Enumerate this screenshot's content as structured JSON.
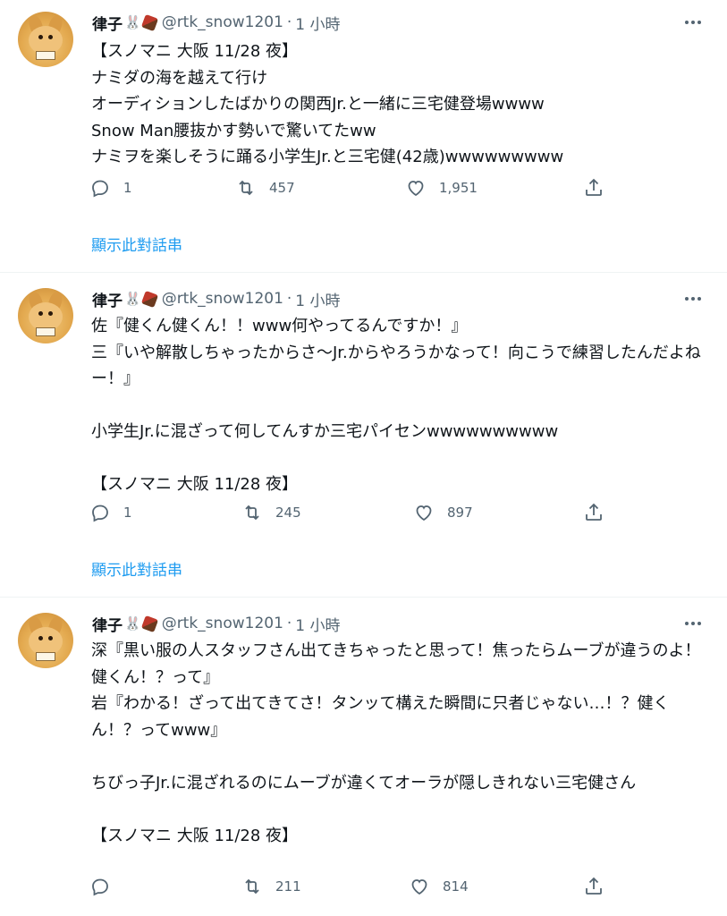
{
  "colors": {
    "link": "#1d9bf0",
    "secondary": "#536471",
    "text": "#0f1419",
    "divider": "#eff3f4"
  },
  "tweets": [
    {
      "name": "律子",
      "name_emoji": "rabbit-and-chocolate",
      "handle": "@rtk_snow1201",
      "dot": "·",
      "time": "1 小時",
      "text": "【スノマニ 大阪 11/28 夜】\nナミダの海を越えて行け\nオーディションしたばかりの関西Jr.と一緒に三宅健登場wwww\nSnow Man腰抜かす勢いで驚いてたww\nナミヲを楽しそうに踊る小学生Jr.と三宅健(42歳)wwwwwwwww",
      "replies": "1",
      "retweets": "457",
      "likes": "1,951",
      "show_thread": "顯示此對話串"
    },
    {
      "name": "律子",
      "name_emoji": "rabbit-and-chocolate",
      "handle": "@rtk_snow1201",
      "dot": "·",
      "time": "1 小時",
      "text": "佐『健くん健くん！！www何やってるんですか！』\n三『いや解散しちゃったからさ〜Jr.からやろうかなって！向こうで練習したんだよねー！』\n\n小学生Jr.に混ざって何してんすか三宅パイセンwwwwwwwwww\n\n【スノマニ 大阪 11/28 夜】",
      "replies": "1",
      "retweets": "245",
      "likes": "897",
      "show_thread": "顯示此對話串"
    },
    {
      "name": "律子",
      "name_emoji": "rabbit-and-chocolate",
      "handle": "@rtk_snow1201",
      "dot": "·",
      "time": "1 小時",
      "text": "深『黒い服の人スタッフさん出てきちゃったと思って！焦ったらムーブが違うのよ！健くん！？って』\n岩『わかる！ざって出てきてさ！タンッて構えた瞬間に只者じゃない…！？健くん！？ってwww』\n\nちびっ子Jr.に混ざれるのにムーブが違くてオーラが隠しきれない三宅健さん\n\n【スノマニ 大阪 11/28 夜】",
      "replies": "",
      "retweets": "211",
      "likes": "814"
    }
  ]
}
